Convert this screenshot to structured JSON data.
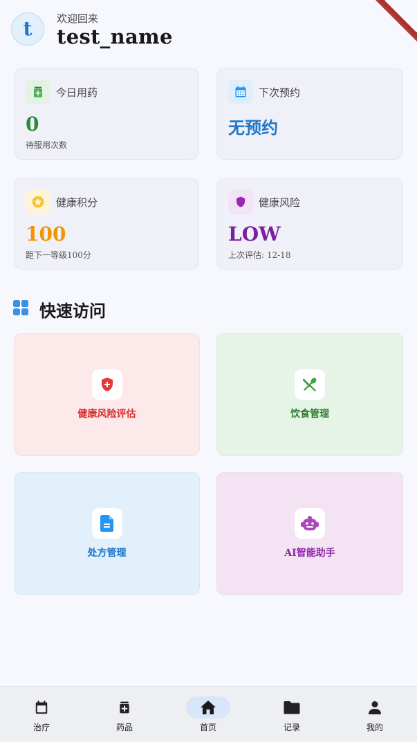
{
  "header": {
    "avatar_letter": "t",
    "welcome": "欢迎回来",
    "username": "test_name"
  },
  "stats": [
    {
      "label": "今日用药",
      "value": "0",
      "sub": "待服用次数",
      "icon": "medicine-bottle-icon",
      "color": "#2f8a3a",
      "icon_bg": "#e3f2e5"
    },
    {
      "label": "下次预约",
      "value": "无预约",
      "sub": "",
      "icon": "calendar-icon",
      "color": "#1e76c8",
      "icon_bg": "#e0eefb"
    },
    {
      "label": "健康积分",
      "value": "100",
      "sub": "距下一等级100分",
      "icon": "star-icon",
      "color": "#f29400",
      "icon_bg": "#fdf4d8"
    },
    {
      "label": "健康风险",
      "value": "LOW",
      "sub": "上次评估: 12-18",
      "icon": "shield-icon",
      "color": "#7b1fa2",
      "icon_bg": "#f3e3f6"
    }
  ],
  "quick_access": {
    "title": "快速访问",
    "items": [
      {
        "label": "健康风险评估",
        "icon": "health-shield-icon",
        "color": "#d32f2f",
        "bg": "#fde9ea"
      },
      {
        "label": "饮食管理",
        "icon": "utensils-icon",
        "color": "#2e7d32",
        "bg": "#e6f4e7"
      },
      {
        "label": "处方管理",
        "icon": "document-icon",
        "color": "#1976d2",
        "bg": "#e2f0fb"
      },
      {
        "label": "AI智能助手",
        "icon": "robot-icon",
        "color": "#8e24aa",
        "bg": "#f3e3f3"
      }
    ]
  },
  "nav": {
    "items": [
      {
        "label": "治疗",
        "icon": "calendar-icon"
      },
      {
        "label": "药品",
        "icon": "medicine-bottle-icon"
      },
      {
        "label": "首页",
        "icon": "home-icon",
        "active": true
      },
      {
        "label": "记录",
        "icon": "folder-icon"
      },
      {
        "label": "我的",
        "icon": "person-icon"
      }
    ]
  }
}
